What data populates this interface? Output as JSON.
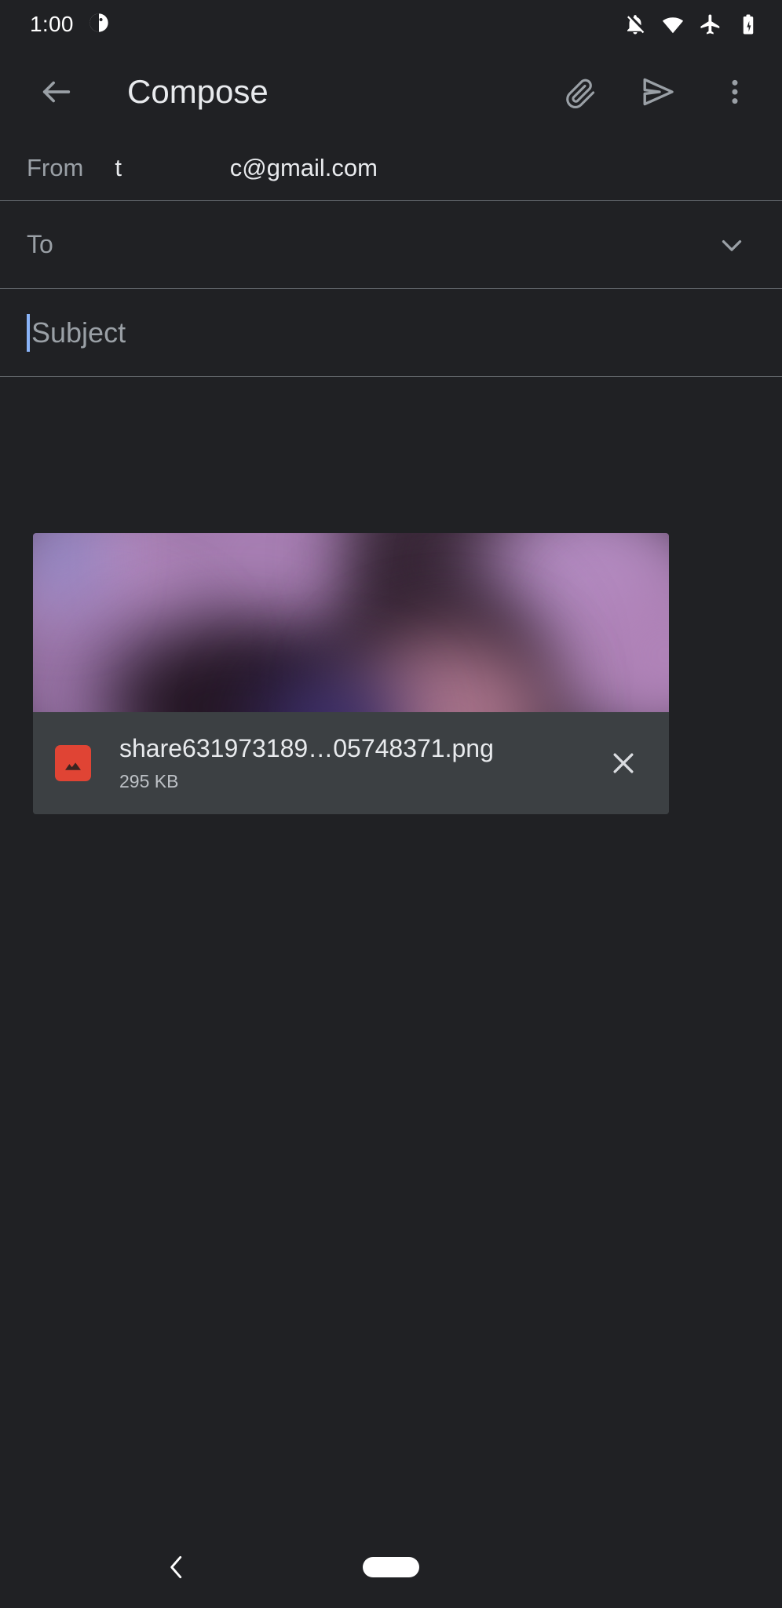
{
  "status_bar": {
    "clock": "1:00",
    "notification_icon": "notification-dot-icon",
    "icons": [
      {
        "name": "notifications-off-icon",
        "label": "Silent mode"
      },
      {
        "name": "wifi-icon",
        "label": "Wi-Fi connected"
      },
      {
        "name": "airplane-mode-icon",
        "label": "Airplane mode"
      },
      {
        "name": "battery-charging-icon",
        "label": "Battery charging"
      }
    ]
  },
  "app_bar": {
    "back_label": "Navigate up",
    "title": "Compose",
    "attach_label": "Attach file",
    "send_label": "Send",
    "more_label": "More options"
  },
  "compose": {
    "from_label": "From",
    "from_value": "t                c@gmail.com",
    "to_placeholder": "To",
    "expand_label": "Show Cc/Bcc",
    "subject_placeholder": "Subject",
    "body_placeholder": ""
  },
  "attachment": {
    "file_name": "share631973189…05748371.png",
    "file_size": "295 KB",
    "file_type_icon": "image-file-icon",
    "remove_label": "Remove attachment",
    "preview_alt": "Blurred purple image preview"
  },
  "nav_bar": {
    "back_label": "Back",
    "home_label": "Home"
  },
  "colors": {
    "background": "#202124",
    "divider": "#5f6368",
    "card_background": "#3c4043",
    "primary_text": "#e8eaed",
    "secondary_text": "#9aa0a6",
    "caret": "#8ab4f8",
    "file_icon": "#e04434",
    "icon_gray": "#9aa0a6"
  }
}
